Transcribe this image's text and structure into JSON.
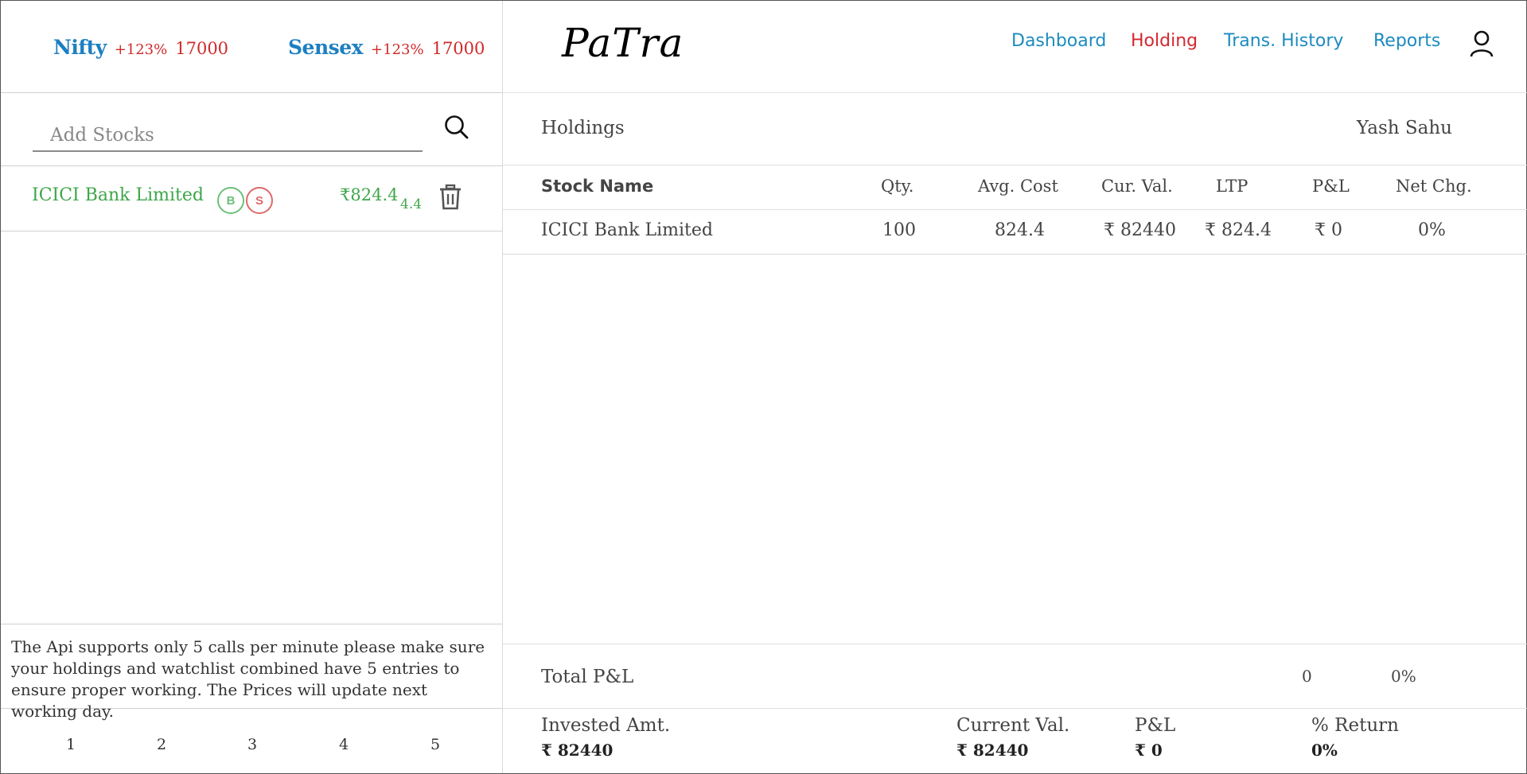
{
  "indices": [
    {
      "name": "Nifty",
      "change": "+123%",
      "value": "17000"
    },
    {
      "name": "Sensex",
      "change": "+123%",
      "value": "17000"
    }
  ],
  "search": {
    "placeholder": "Add Stocks"
  },
  "watchlist": [
    {
      "name": "ICICI Bank Limited",
      "buy_label": "B",
      "sell_label": "S",
      "price": "₹824.4",
      "change": "4.4"
    }
  ],
  "notice": "The Api supports only 5 calls per minute please make sure your holdings and watchlist combined have 5 entries to ensure proper working. The Prices will update next working day.",
  "pagination": [
    "1",
    "2",
    "3",
    "4",
    "5"
  ],
  "brand": {
    "logo": "PaTra"
  },
  "nav": {
    "dashboard": "Dashboard",
    "holding": "Holding",
    "trans_history": "Trans. History",
    "reports": "Reports"
  },
  "page": {
    "title": "Holdings",
    "user": "Yash Sahu"
  },
  "table": {
    "headers": {
      "stock": "Stock Name",
      "qty": "Qty.",
      "avg": "Avg. Cost",
      "cur": "Cur. Val.",
      "ltp": "LTP",
      "pl": "P&L",
      "net": "Net Chg."
    },
    "rows": [
      {
        "stock": "ICICI Bank Limited",
        "qty": "100",
        "avg": "824.4",
        "cur": "₹ 82440",
        "ltp": "₹ 824.4",
        "pl": "₹ 0",
        "net": "0%"
      }
    ]
  },
  "total": {
    "label": "Total P&L",
    "pl": "0",
    "pct": "0%"
  },
  "summary": {
    "invested_label": "Invested Amt.",
    "invested_value": "₹  82440",
    "current_label": "Current Val.",
    "current_value": "₹  82440",
    "pl_label": "P&L",
    "pl_value": "₹  0",
    "return_label": "% Return",
    "return_value": "0%"
  },
  "colors": {
    "index_name": "#1d7fc1",
    "negative": "#cf2a2a",
    "positive": "#3fa64a",
    "nav": "#1d8bbf",
    "nav_active": "#d4282f"
  },
  "icons": {
    "search": "search-icon",
    "trash": "trash-icon",
    "user": "user-icon"
  }
}
